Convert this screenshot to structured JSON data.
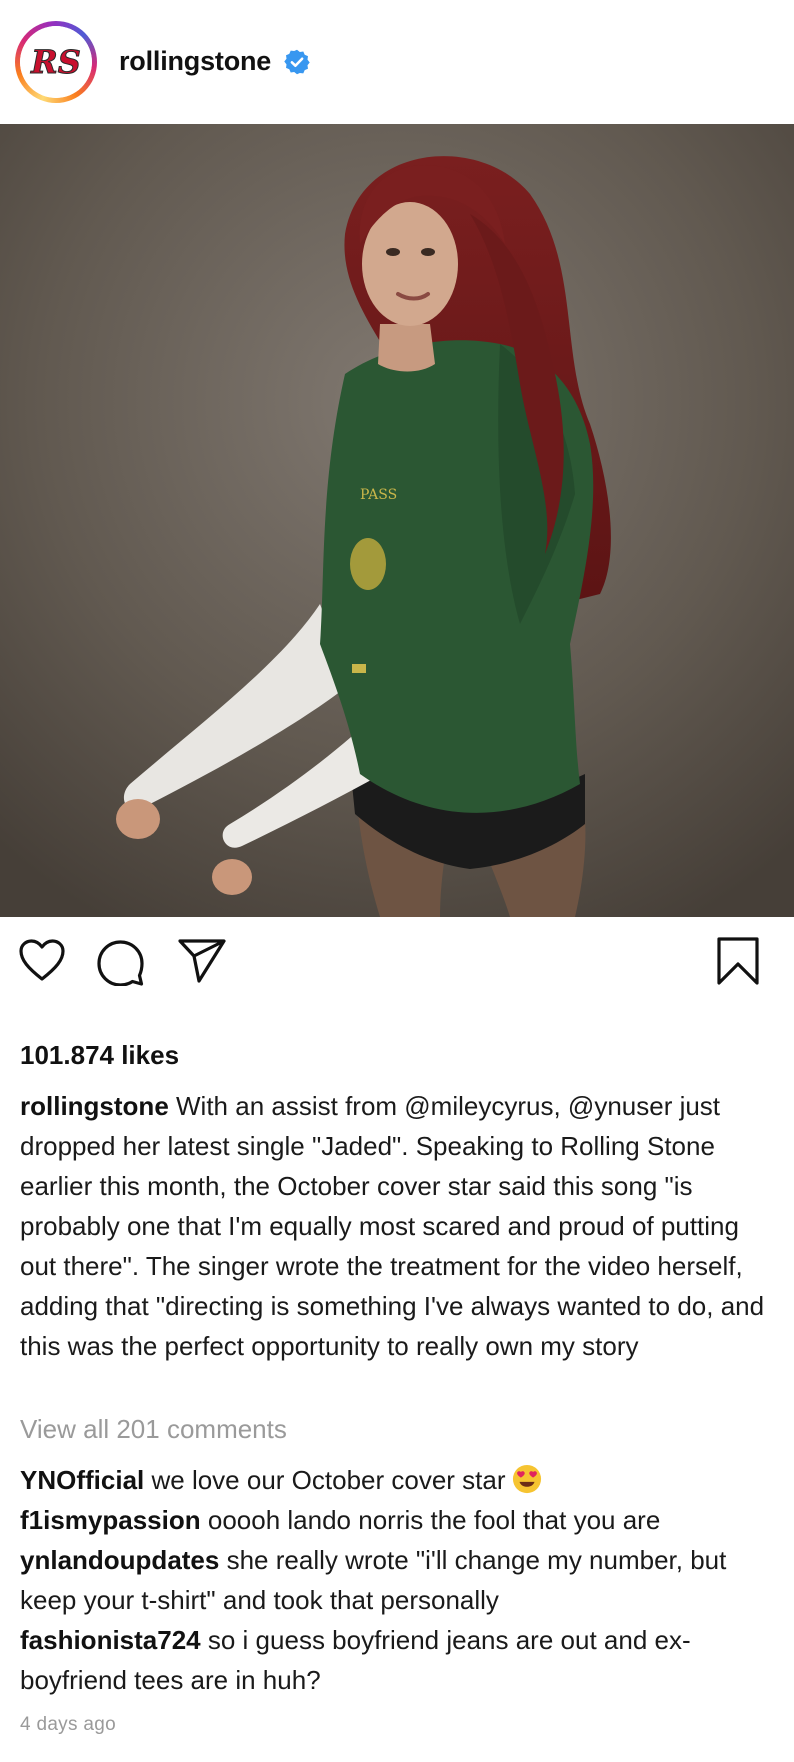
{
  "post": {
    "username": "rollingstone",
    "avatar_text": "RS",
    "verified": true,
    "likes": "101.874 likes",
    "caption_user": "rollingstone",
    "caption_text": "With an assist from @mileycyrus, @ynuser just dropped her latest single \"Jaded\". Speaking to Rolling Stone earlier this month, the October cover star said this song \"is probably one that I'm equally most scared and proud of putting out there\". The singer wrote the treatment for the video herself, adding that \"directing is something I've always wanted to do, and this was the perfect opportunity to really own my story",
    "view_all": "View all 201 comments",
    "time": "4 days ago"
  },
  "photo": {
    "shirt_text": "PASS"
  },
  "icons": {
    "like": "heart-icon",
    "comment": "comment-icon",
    "share": "share-icon",
    "save": "bookmark-icon",
    "verified": "verified-badge-icon",
    "emoji": "heart-eyes-emoji"
  },
  "comments": [
    {
      "user": "YNOfficial",
      "text": "we love our October cover star",
      "emoji": "heart-eyes"
    },
    {
      "user": "f1ismypassion",
      "text": "ooooh lando norris the fool that you are"
    },
    {
      "user": "ynlandoupdates",
      "text": "she really wrote \"i'll change my number, but keep your t-shirt\" and took that personally"
    },
    {
      "user": "fashionista724",
      "text": "so i guess boyfriend jeans are out and ex-boyfriend tees are in huh?"
    }
  ],
  "colors": {
    "verified": "#3897f0",
    "muted": "#9a9a9a",
    "text": "#111111"
  }
}
